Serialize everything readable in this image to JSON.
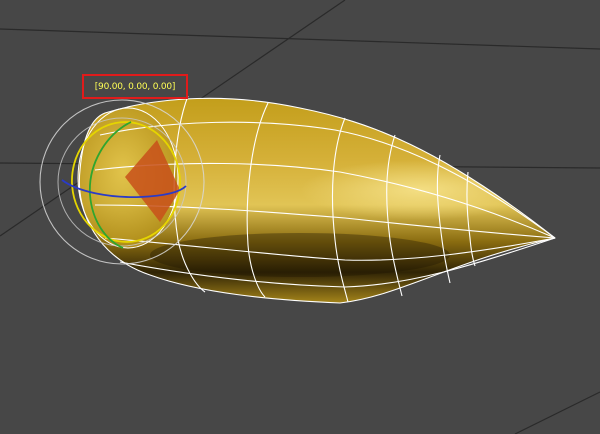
{
  "viewport": {
    "background_color": "#474747",
    "grid_line_color": "#2a2a2a"
  },
  "object": {
    "shape": "bullet-nose-mesh",
    "fill_color": "#c9a227",
    "shadow_color": "#3a2c05",
    "wireframe_color": "#ffffff"
  },
  "rotate_gizmo": {
    "icon": "rotate-gizmo-icon",
    "ring_colors": {
      "outer": "#d8d8d8",
      "x_axis": "#e5d500",
      "y_axis": "#2fa52f",
      "z_axis": "#2a3bc8",
      "pie": "#c8501a"
    },
    "readout": "[90.00, 0.00, 0.00]",
    "readout_text_color": "#ffff55",
    "readout_border_color": "#e01b1b"
  }
}
